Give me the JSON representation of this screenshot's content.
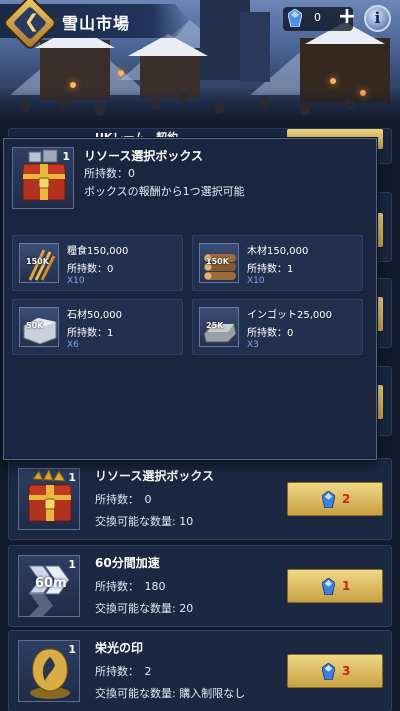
{
  "header": {
    "title": "雪山市場",
    "resource_count": "0",
    "plus_label": "+",
    "info_label": "i"
  },
  "colors": {
    "accent_gold": "#e8c86b",
    "price_red": "#d11e1e",
    "quantity_blue": "#7fa3e6",
    "panel": "#1c2842"
  },
  "popup": {
    "badge": "1",
    "title": "リソース選択ボックス",
    "owned": "所持数：0",
    "description": "ボックスの報酬から1つ選択可能",
    "options": [
      {
        "name": "糧食150,000",
        "owned": "所持数：0",
        "qty": "X10",
        "tag": "150K",
        "icon": "wheat-icon"
      },
      {
        "name": "木材150,000",
        "owned": "所持数：1",
        "qty": "X10",
        "tag": "150K",
        "icon": "wood-logs-icon"
      },
      {
        "name": "石材50,000",
        "owned": "所持数：1",
        "qty": "X6",
        "tag": "50K",
        "icon": "stone-block-icon"
      },
      {
        "name": "インゴット25,000",
        "owned": "所持数：0",
        "qty": "X3",
        "tag": "25K",
        "icon": "ingot-icon"
      }
    ]
  },
  "items": [
    {
      "badge": "1",
      "name": "リソース選択ボックス",
      "owned": "所持数：　0",
      "exchange": "交換可能な数量: 10",
      "price": "2",
      "icon": "treasure-chest-icon"
    },
    {
      "badge": "1",
      "name": "60分間加速",
      "owned": "所持数：　180",
      "exchange": "交換可能な数量: 20",
      "price": "1",
      "icon": "speedup-60m-icon",
      "icon_text": "60m"
    },
    {
      "badge": "1",
      "name": "栄光の印",
      "owned": "所持数：　2",
      "exchange": "交換可能な数量: 購入制限なし",
      "price": "3",
      "icon": "glory-emblem-icon"
    }
  ],
  "partial_row_text": "UKレーム　契約"
}
